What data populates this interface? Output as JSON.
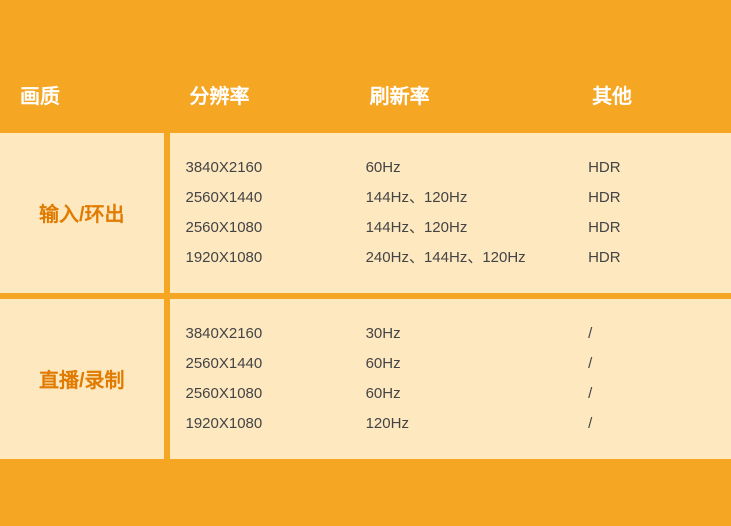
{
  "header": {
    "col1": "画质",
    "col2": "分辨率",
    "col3": "刷新率",
    "col4": "其他"
  },
  "rows": [
    {
      "category": "输入/环出",
      "resolutions": [
        "3840X2160",
        "2560X1440",
        "2560X1080",
        "1920X1080"
      ],
      "refresh_rates": [
        "60Hz",
        "144Hz、120Hz",
        "144Hz、120Hz",
        "240Hz、144Hz、120Hz"
      ],
      "others": [
        "HDR",
        "HDR",
        "HDR",
        "HDR"
      ]
    },
    {
      "category": "直播/录制",
      "resolutions": [
        "3840X2160",
        "2560X1440",
        "2560X1080",
        "1920X1080"
      ],
      "refresh_rates": [
        "30Hz",
        "60Hz",
        "60Hz",
        "120Hz"
      ],
      "others": [
        "/",
        "/",
        "/",
        "/"
      ]
    }
  ],
  "colors": {
    "background": "#f5a623",
    "cell_bg": "#fde8c0",
    "header_text": "#ffffff",
    "category_text": "#e07b00",
    "data_text": "#444444"
  }
}
